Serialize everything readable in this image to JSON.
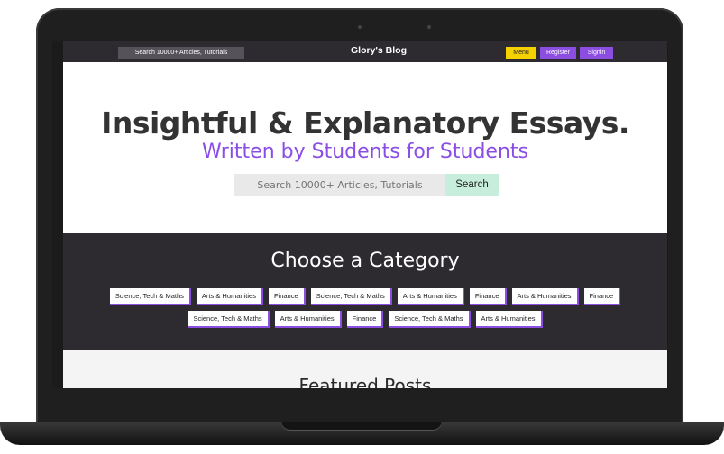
{
  "topbar": {
    "search_placeholder": "Search 10000+ Articles, Tutorials",
    "brand": "Glory's Blog",
    "menu_label": "Menu",
    "register_label": "Register",
    "signin_label": "Signin"
  },
  "hero": {
    "title": "Insightful & Explanatory Essays.",
    "subtitle": "Written by Students for Students",
    "search_placeholder": "Search 10000+ Articles, Tutorials",
    "search_button": "Search"
  },
  "categories": {
    "heading": "Choose a Category",
    "row1": [
      "Science, Tech & Maths",
      "Arts & Humanities",
      "Finance",
      "Science, Tech & Maths",
      "Arts & Humanities",
      "Finance",
      "Arts & Humanities",
      "Finance"
    ],
    "row2": [
      "Science, Tech & Maths",
      "Arts & Humanities",
      "Finance",
      "Science, Tech & Maths",
      "Arts & Humanities"
    ]
  },
  "featured": {
    "heading": "Featured Posts"
  },
  "colors": {
    "accent": "#8b4ee0",
    "menu_yellow": "#f5d100",
    "dark_bg": "#2d2a30",
    "search_button_bg": "#c7eedd"
  }
}
